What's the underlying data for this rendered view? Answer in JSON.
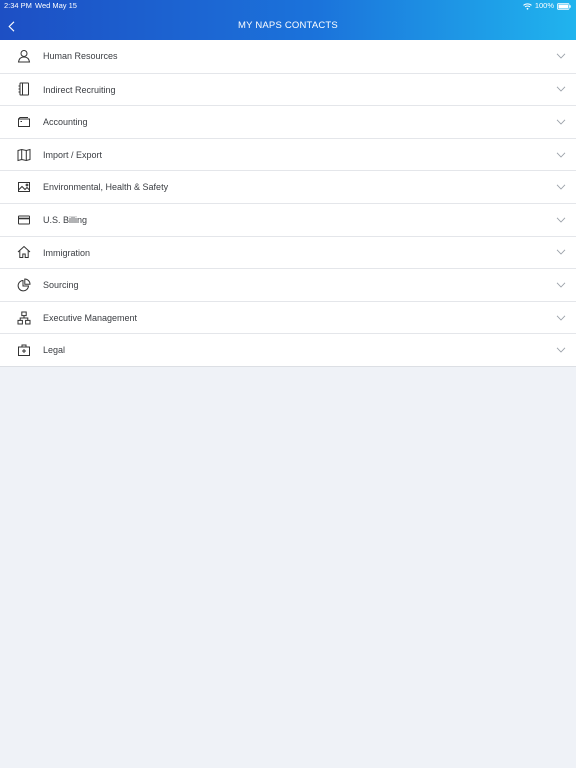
{
  "status_bar": {
    "time": "2:34 PM",
    "date": "Wed May 15",
    "battery": "100%",
    "wifi_icon": "wifi-icon",
    "battery_icon": "battery-icon"
  },
  "nav": {
    "title": "MY NAPS CONTACTS",
    "back_icon": "chevron-left-icon"
  },
  "colors": {
    "header_gradient_start": "#1d4fc4",
    "header_gradient_end": "#20b4ee",
    "background": "#eff2f7"
  },
  "departments": [
    {
      "label": "Human Resources",
      "icon": "person-icon"
    },
    {
      "label": "Indirect Recruiting",
      "icon": "notebook-icon"
    },
    {
      "label": "Accounting",
      "icon": "wallet-icon"
    },
    {
      "label": "Import / Export",
      "icon": "map-icon"
    },
    {
      "label": "Environmental, Health & Safety",
      "icon": "image-icon"
    },
    {
      "label": "U.S. Billing",
      "icon": "credit-card-icon"
    },
    {
      "label": "Immigration",
      "icon": "home-icon"
    },
    {
      "label": "Sourcing",
      "icon": "pie-chart-icon"
    },
    {
      "label": "Executive Management",
      "icon": "org-chart-icon"
    },
    {
      "label": "Legal",
      "icon": "briefcase-icon"
    }
  ]
}
